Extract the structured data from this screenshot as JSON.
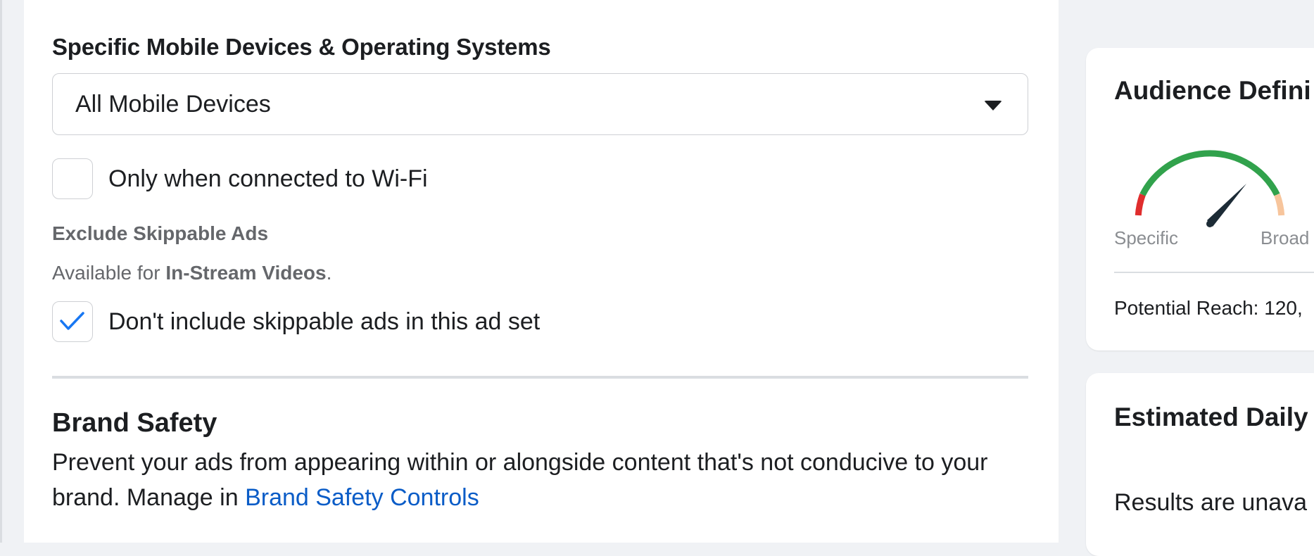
{
  "devices": {
    "label": "Specific Mobile Devices & Operating Systems",
    "selected": "All Mobile Devices"
  },
  "wifi": {
    "label": "Only when connected to Wi-Fi",
    "checked": false
  },
  "skippable": {
    "heading": "Exclude Skippable Ads",
    "available_prefix": "Available for ",
    "available_bold": "In-Stream Videos",
    "available_suffix": ".",
    "checkbox_label": "Don't include skippable ads in this ad set",
    "checked": true
  },
  "brand_safety": {
    "title": "Brand Safety",
    "description": "Prevent your ads from appearing within or alongside content that's not conducive to your brand. Manage in ",
    "link": "Brand Safety Controls"
  },
  "audience": {
    "title": "Audience Defini",
    "gauge_low": "Specific",
    "gauge_high": "Broad",
    "reach": "Potential Reach: 120,"
  },
  "estimate": {
    "title": "Estimated Daily",
    "results": "Results are unava"
  },
  "colors": {
    "accent": "#1877f2",
    "link": "#0a5cc7",
    "gauge_green": "#31a24c",
    "gauge_red": "#e02d2d",
    "gauge_peach": "#f7c59c"
  }
}
